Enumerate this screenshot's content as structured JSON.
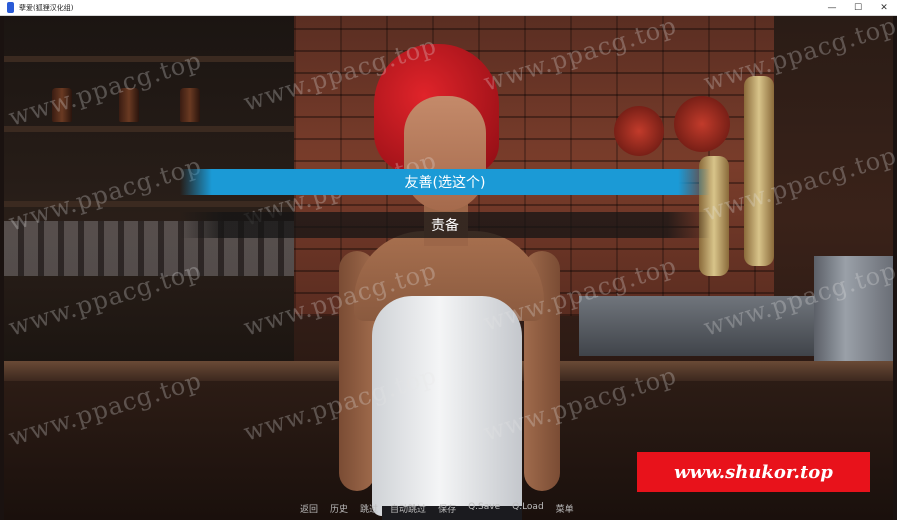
{
  "window": {
    "title": "孽爱(狐狸汉化组)",
    "controls": {
      "minimize": "—",
      "maximize": "☐",
      "close": "✕"
    }
  },
  "choices": [
    {
      "label": "友善(选这个)",
      "selected": true
    },
    {
      "label": "责备",
      "selected": false
    }
  ],
  "quick_menu": [
    "返回",
    "历史",
    "跳过",
    "自动跳过",
    "保存",
    "Q.Save",
    "Q.Load",
    "菜单"
  ],
  "watermark_text": "www.ppacg.top",
  "promo_banner": "www.shukor.top",
  "colors": {
    "choice_selected": "#1b9ad6",
    "promo_bg": "#e8121b",
    "hair": "#d42028"
  }
}
